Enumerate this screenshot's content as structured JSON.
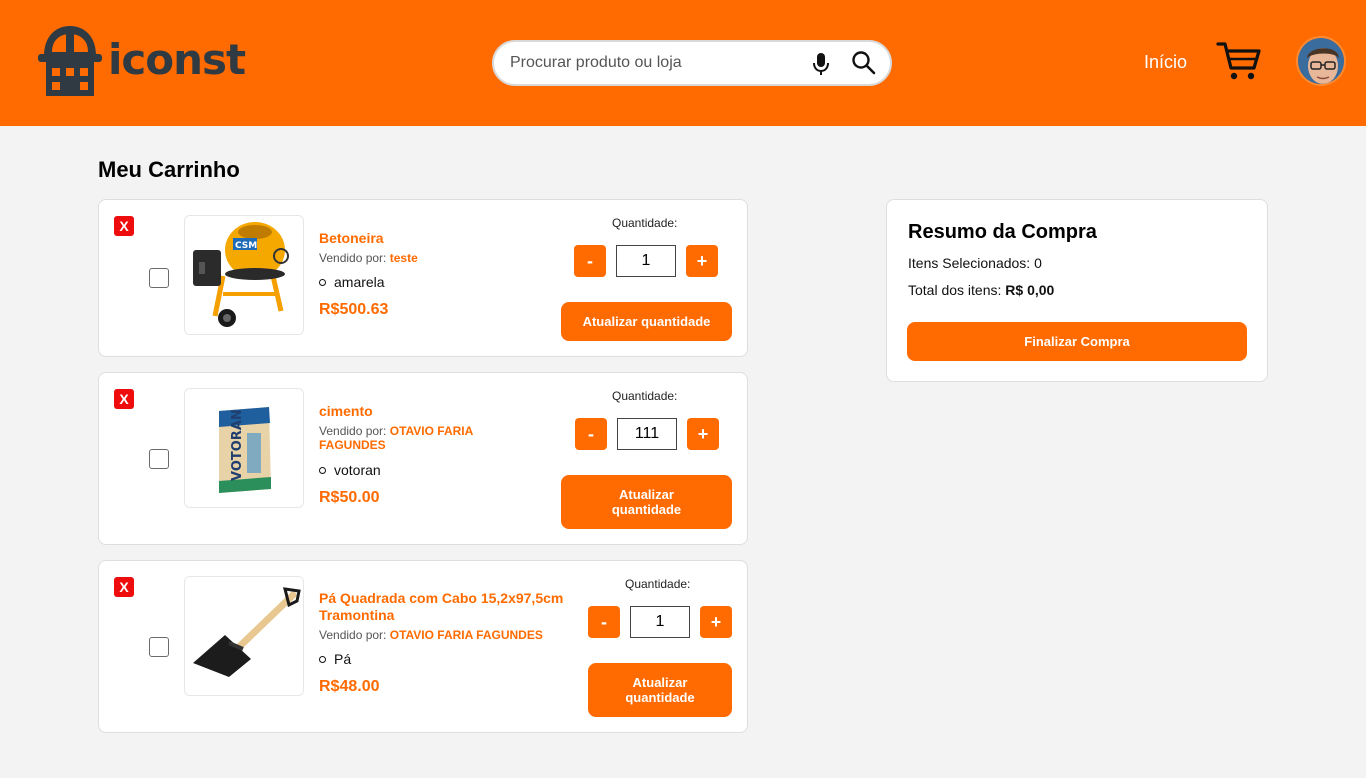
{
  "header": {
    "logo_text": "iconst",
    "search": {
      "placeholder": "Procurar produto ou loja",
      "value": ""
    },
    "nav_inicio": "Início",
    "brand_color": "#ff6b00"
  },
  "page_title": "Meu Carrinho",
  "cart": {
    "items": [
      {
        "remove_label": "X",
        "name": "Betoneira",
        "seller_prefix": "Vendido por: ",
        "seller": "teste",
        "variant": "amarela",
        "price": "R$500.63",
        "qty_label": "Quantidade:",
        "minus": "-",
        "qty": "1",
        "plus": "+",
        "update_label": "Atualizar quantidade",
        "image_icon": "concrete-mixer-image"
      },
      {
        "remove_label": "X",
        "name": "cimento",
        "seller_prefix": "Vendido por: ",
        "seller": "OTAVIO FARIA FAGUNDES",
        "variant": "votoran",
        "price": "R$50.00",
        "qty_label": "Quantidade:",
        "minus": "-",
        "qty": "111",
        "plus": "+",
        "update_label": "Atualizar quantidade",
        "image_icon": "cement-bag-image",
        "image_text": "VOTORAN"
      },
      {
        "remove_label": "X",
        "name": "Pá Quadrada com Cabo 15,2x97,5cm Tramontina",
        "seller_prefix": "Vendido por: ",
        "seller": "OTAVIO FARIA FAGUNDES",
        "variant": "Pá",
        "price": "R$48.00",
        "qty_label": "Quantidade:",
        "minus": "-",
        "qty": "1",
        "plus": "+",
        "update_label": "Atualizar quantidade",
        "image_icon": "shovel-image"
      }
    ]
  },
  "summary": {
    "title": "Resumo da Compra",
    "selected_label": "Itens Selecionados: ",
    "selected_count": "0",
    "total_label": "Total dos itens: ",
    "total_value": "R$ 0,00",
    "finalize_label": "Finalizar Compra"
  }
}
